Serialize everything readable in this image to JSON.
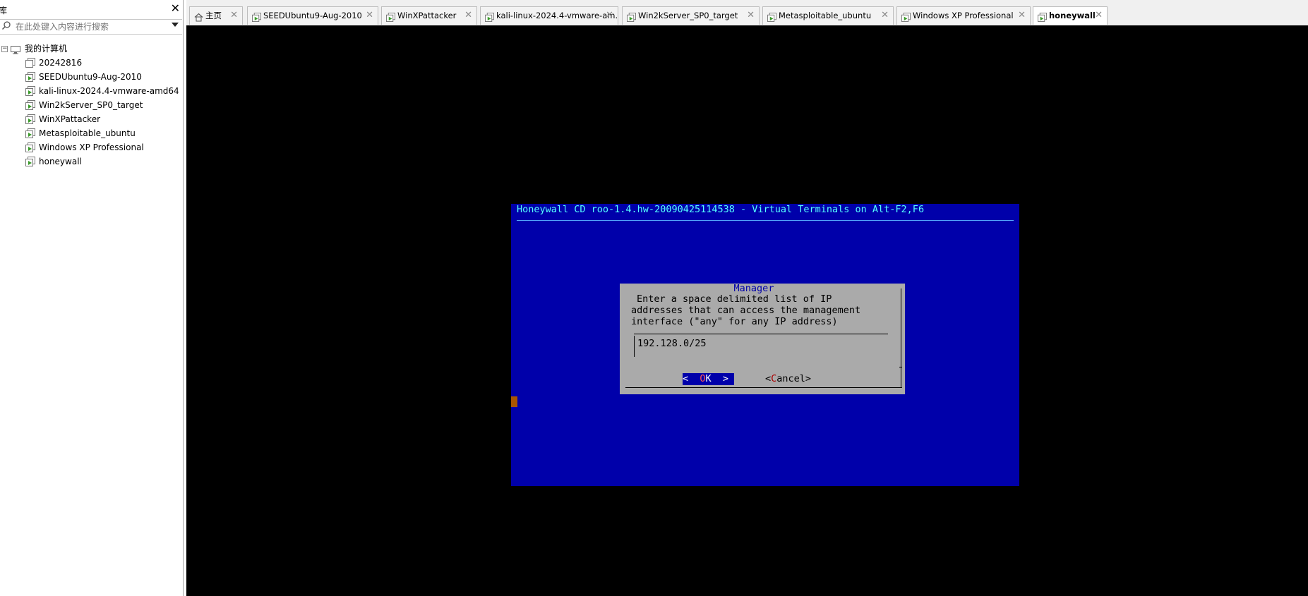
{
  "sidebar": {
    "title_glyph": "库",
    "close_glyph": "✕",
    "search": {
      "placeholder": "在此处键入内容进行搜索"
    },
    "tree": {
      "root_label": "我的计算机",
      "toggle": "−",
      "items": [
        {
          "label": "20242816"
        },
        {
          "label": "SEEDUbuntu9-Aug-2010"
        },
        {
          "label": "kali-linux-2024.4-vmware-amd64"
        },
        {
          "label": "Win2kServer_SP0_target"
        },
        {
          "label": "WinXPattacker"
        },
        {
          "label": "Metasploitable_ubuntu"
        },
        {
          "label": "Windows XP Professional"
        },
        {
          "label": "honeywall"
        }
      ]
    }
  },
  "tabs": [
    {
      "label": "主页",
      "icon": "home-icon"
    },
    {
      "label": "SEEDUbuntu9-Aug-2010",
      "icon": "vm-icon"
    },
    {
      "label": "WinXPattacker",
      "icon": "vm-icon"
    },
    {
      "label": "kali-linux-2024.4-vmware-am...",
      "icon": "vm-icon"
    },
    {
      "label": "Win2kServer_SP0_target",
      "icon": "vm-icon"
    },
    {
      "label": "Metasploitable_ubuntu",
      "icon": "vm-icon"
    },
    {
      "label": "Windows XP Professional",
      "icon": "vm-icon"
    },
    {
      "label": "honeywall",
      "icon": "vm-icon"
    }
  ],
  "tab_close_glyph": "✕",
  "console": {
    "title": "Honeywall CD roo-1.4.hw-20090425114538 - Virtual Terminals on Alt-F2,F6",
    "dialog": {
      "title": "Manager",
      "lines": [
        "Enter a space delimited list of IP",
        "addresses that can access the management",
        "interface (\"any\" for any IP address)"
      ],
      "input_value": "192.128.0/25",
      "ok_prefix": "<  ",
      "ok_hot": "O",
      "ok_rest": "K",
      "ok_suffix": "  >",
      "cancel_prefix": "<",
      "cancel_hot": "C",
      "cancel_rest": "ancel>"
    }
  },
  "colors": {
    "console_bg": "#0000aa",
    "console_title": "#55ffff",
    "dialog_bg": "#aaaaaa",
    "hotkey": "#ff5555",
    "cursor": "#aa5500",
    "vm_icon_green": "#3a9a2a"
  }
}
